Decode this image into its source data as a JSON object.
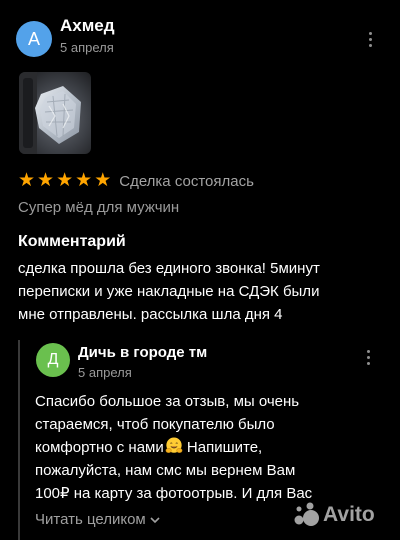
{
  "review": {
    "author_initial": "А",
    "author_name": "Ахмед",
    "date": "5 апреля",
    "rating": 5,
    "rating_max": 5,
    "deal_status": "Сделка состоялась",
    "subtitle": "Супер мёд для мужчин",
    "comment_title": "Комментарий",
    "comment_lines": [
      "сделка прошла без единого звонка! 5минут",
      "переписки и уже накладные на СДЭК были",
      "мне отправлены. рассылка шла дня 4"
    ]
  },
  "reply": {
    "author_initial": "Д",
    "author_name": "Дичь в городе тм",
    "date": "5 апреля",
    "text_lines": [
      "Спасибо большое за отзыв, мы очень",
      "стараемся, чтоб покупателю было",
      "комфортно с нами",
      "пожалуйста, нам смс мы вернем Вам",
      "100₽ на карту за фотоотрыв. И для Вас"
    ],
    "line3_suffix": " Напишите,",
    "emoji_name": "hugging-face-emoji",
    "read_more": "Читать целиком"
  },
  "watermark": {
    "text": "Avito"
  },
  "colors": {
    "background": "#000000",
    "star": "#ffa500",
    "avatar_author": "#53a2ea",
    "avatar_reply": "#6ac04e",
    "muted_text": "#9a9a9a"
  },
  "icons": {
    "more": "more-vertical-icon",
    "star": "star-icon",
    "chevron": "chevron-down-icon"
  }
}
